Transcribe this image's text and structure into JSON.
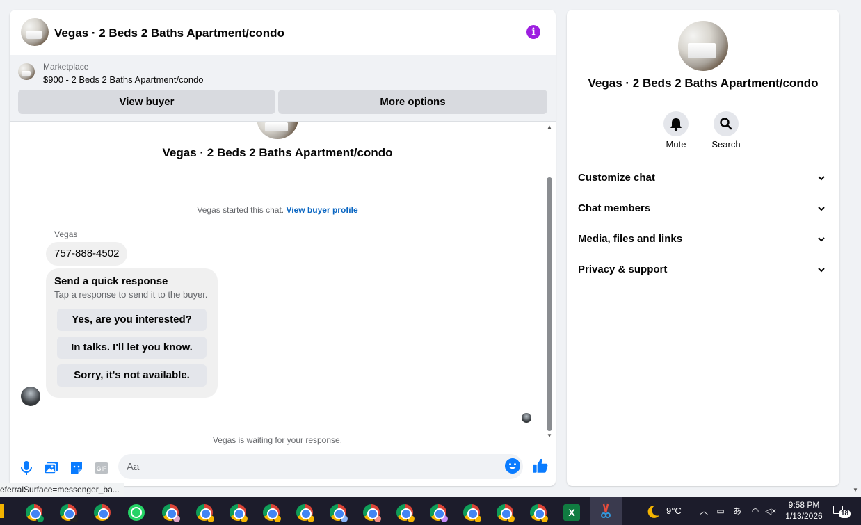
{
  "chat": {
    "title": "Vegas · 2 Beds 2 Baths Apartment/condo",
    "marketplace_label": "Marketplace",
    "listing_text": "$900 - 2 Beds 2 Baths Apartment/condo",
    "view_buyer_label": "View buyer",
    "more_options_label": "More options",
    "conversation_title": "Vegas · 2 Beds 2 Baths Apartment/condo",
    "started_text": "Vegas started this chat.",
    "view_profile_link": "View buyer profile",
    "sender_name": "Vegas",
    "phone_message": "757-888-4502",
    "quick_title": "Send a quick response",
    "quick_subtitle": "Tap a response to send it to the buyer.",
    "quick_responses": [
      "Yes, are you interested?",
      "In talks. I'll let you know.",
      "Sorry, it's not available."
    ],
    "waiting_text": "Vegas is waiting for your response.",
    "input_placeholder": "Aa"
  },
  "details": {
    "title": "Vegas · 2 Beds 2 Baths Apartment/condo",
    "mute_label": "Mute",
    "search_label": "Search",
    "sections": [
      "Customize chat",
      "Chat members",
      "Media, files and links",
      "Privacy & support"
    ]
  },
  "status_bar": {
    "url_fragment": "eferralSurface=messenger_ba..."
  },
  "taskbar": {
    "temperature": "9°C",
    "time": "9:58 PM",
    "date": "1/13/2026",
    "notification_count": "18",
    "excel_letter": "X"
  },
  "colors": {
    "accent": "#0a7cff",
    "info_purple": "#9d1fe0",
    "link_blue": "#0a66c2",
    "taskbar": "#1c1c2b"
  }
}
